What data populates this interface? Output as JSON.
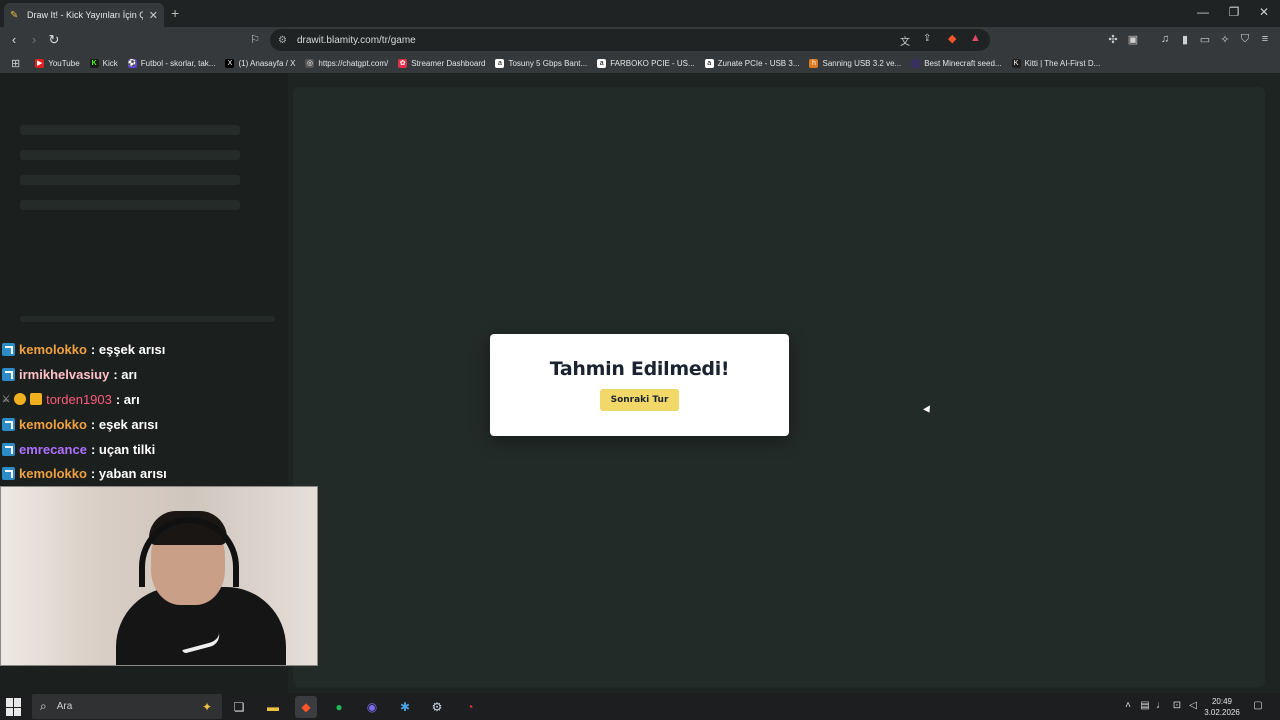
{
  "browser": {
    "tab_title": "Draw It! - Kick Yayınları İçin Çizim",
    "url": "drawit.blamity.com/tr/game"
  },
  "bookmarks": [
    {
      "label": "YouTube",
      "icon": "youtube-icon",
      "color": "#e02020"
    },
    {
      "label": "Kick",
      "icon": "kick-icon",
      "color": "#53fc18"
    },
    {
      "label": "Futbol - skorlar, tak...",
      "icon": "futbol-icon",
      "color": "#5b3fd6"
    },
    {
      "label": "(1) Anasayfa / X",
      "icon": "x-icon",
      "color": "#000000"
    },
    {
      "label": "https://chatgpt.com/",
      "icon": "chatgpt-icon",
      "color": "#888888"
    },
    {
      "label": "Streamer Dashboard",
      "icon": "streamer-icon",
      "color": "#e0304a"
    },
    {
      "label": "Tosuny 5 Gbps Bant...",
      "icon": "amazon-icon",
      "color": "#ffffff"
    },
    {
      "label": "FARBOKO PCIE - US...",
      "icon": "amazon-icon",
      "color": "#ffffff"
    },
    {
      "label": "Zunate PCIe - USB 3...",
      "icon": "amazon-icon",
      "color": "#ffffff"
    },
    {
      "label": "Sanning USB 3.2 ve...",
      "icon": "hb-icon",
      "color": "#e07a20"
    },
    {
      "label": "Best Minecraft seed...",
      "icon": "minecraft-icon",
      "color": "#3a3060"
    },
    {
      "label": "Kitti | The AI-First D...",
      "icon": "kitti-icon",
      "color": "#202020"
    }
  ],
  "chat": [
    {
      "user": "kemolokko",
      "user_color": "#f0a040",
      "message": ": eşşek arısı",
      "badges": [
        "verified"
      ]
    },
    {
      "user": "irmikhelvasiuy",
      "user_color": "#ffc0c8",
      "message": ": arı",
      "badges": [
        "verified"
      ]
    },
    {
      "user": "torden1903",
      "user_color": "#ff5a7a",
      "message": ": arı",
      "badges": [
        "mod",
        "level",
        "crown"
      ]
    },
    {
      "user": "kemolokko",
      "user_color": "#f0a040",
      "message": ": eşek arısı",
      "badges": [
        "verified"
      ]
    },
    {
      "user": "emrecance",
      "user_color": "#b070ff",
      "message": ": uçan tilki",
      "badges": [
        "verified"
      ]
    },
    {
      "user": "kemolokko",
      "user_color": "#f0a040",
      "message": ": yaban arısı",
      "badges": [
        "verified"
      ]
    }
  ],
  "dialog": {
    "title": "Tahmin Edilmedi!",
    "button": "Sonraki Tur"
  },
  "taskbar": {
    "search_placeholder": "Ara",
    "time": "20:49",
    "date": "3.02.2026"
  }
}
